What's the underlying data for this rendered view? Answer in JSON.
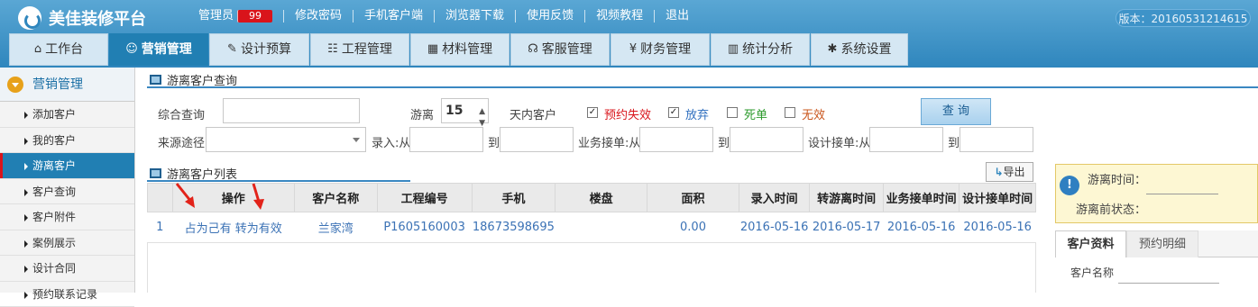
{
  "app": {
    "title": "美佳装修平台",
    "version": "版本：20160531214615"
  },
  "topnav": {
    "user": "管理员",
    "badge": "99",
    "items": [
      "修改密码",
      "手机客户端",
      "浏览器下载",
      "使用反馈",
      "视频教程",
      "退出"
    ]
  },
  "tabs": [
    {
      "label": "工作台",
      "icon": "⌂"
    },
    {
      "label": "营销管理",
      "icon": "☺"
    },
    {
      "label": "设计预算",
      "icon": "✎"
    },
    {
      "label": "工程管理",
      "icon": "☷"
    },
    {
      "label": "材料管理",
      "icon": "▦"
    },
    {
      "label": "客服管理",
      "icon": "☊"
    },
    {
      "label": "财务管理",
      "icon": "¥"
    },
    {
      "label": "统计分析",
      "icon": "▥"
    },
    {
      "label": "系统设置",
      "icon": "✱"
    }
  ],
  "sidebar": {
    "title": "营销管理",
    "items": [
      "添加客户",
      "我的客户",
      "游离客户",
      "客户查询",
      "客户附件",
      "案例展示",
      "设计合同",
      "预约联系记录"
    ]
  },
  "query": {
    "title": "游离客户查询",
    "combined_label": "综合查询",
    "youli_label": "游离",
    "days_value": "15",
    "days_suffix": "天内客户",
    "checks": [
      {
        "label": "预约失效",
        "checked": true,
        "color": "#d9141b"
      },
      {
        "label": "放弃",
        "checked": true,
        "color": "#2f6fbf"
      },
      {
        "label": "死单",
        "checked": false,
        "color": "#2b9a2b"
      },
      {
        "label": "无效",
        "checked": false,
        "color": "#c9541a"
      }
    ],
    "button": "查 询",
    "source_label": "来源途径",
    "entry_label": "录入:从",
    "to1": "到",
    "business_label": "业务接单:从",
    "to2": "到",
    "design_label": "设计接单:从",
    "to3": "到"
  },
  "list": {
    "title": "游离客户列表",
    "export": "导出",
    "headers": [
      "",
      "操作",
      "客户名称",
      "工程编号",
      "手机",
      "楼盘",
      "面积",
      "录入时间",
      "转游离时间",
      "业务接单时间",
      "设计接单时间"
    ],
    "rows": [
      {
        "num": "1",
        "op1": "占为己有",
        "op2": "转为有效",
        "name": "兰家湾",
        "code": "P1605160003",
        "phone": "18673598695",
        "estate": "",
        "area": "0.00",
        "entry": "2016-05-16",
        "free": "2016-05-17",
        "business": "2016-05-16",
        "design": "2016-05-16"
      }
    ]
  },
  "right": {
    "free_time": "游离时间：",
    "prev_status": "游离前状态：",
    "tab1": "客户资料",
    "tab2": "预约明细",
    "customer_name": "客户名称"
  }
}
